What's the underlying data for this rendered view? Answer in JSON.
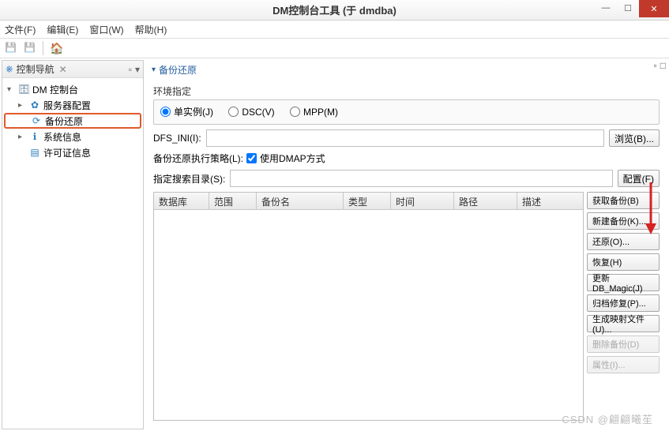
{
  "window": {
    "title": "DM控制台工具 (于 dmdba)"
  },
  "menu": {
    "file": "文件(F)",
    "edit": "编辑(E)",
    "window": "窗口(W)",
    "help": "帮助(H)"
  },
  "nav": {
    "panel_title": "控制导航",
    "close_x": "✕",
    "root": "DM 控制台",
    "items": {
      "server_config": "服务器配置",
      "backup_restore": "备份还原",
      "system_info": "系统信息",
      "license_info": "许可证信息"
    }
  },
  "main": {
    "section_title": "备份还原",
    "env_label": "环境指定",
    "radios": {
      "single": "单实例(J)",
      "dsc": "DSC(V)",
      "mpp": "MPP(M)"
    },
    "dfs_label": "DFS_INI(I):",
    "browse_btn": "浏览(B)...",
    "strategy_label": "备份还原执行策略(L):",
    "strategy_checkbox": "使用DMAP方式",
    "search_dir_label": "指定搜索目录(S):",
    "config_btn": "配置(F)",
    "columns": {
      "db": "数据库",
      "scope": "范围",
      "name": "备份名",
      "type": "类型",
      "time": "时间",
      "path": "路径",
      "desc": "描述"
    },
    "side_buttons": {
      "get_backup": "获取备份(B)",
      "new_backup": "新建备份(K)...",
      "restore": "还原(O)...",
      "recover": "恢复(H)",
      "update_magic": "更新DB_Magic(J)",
      "archive_fix": "归档修复(P)...",
      "gen_map": "生成映射文件(U)...",
      "delete_backup": "删除备份(D)",
      "properties": "属性(I)..."
    }
  },
  "watermark": "CSDN @翩翩曦苼"
}
